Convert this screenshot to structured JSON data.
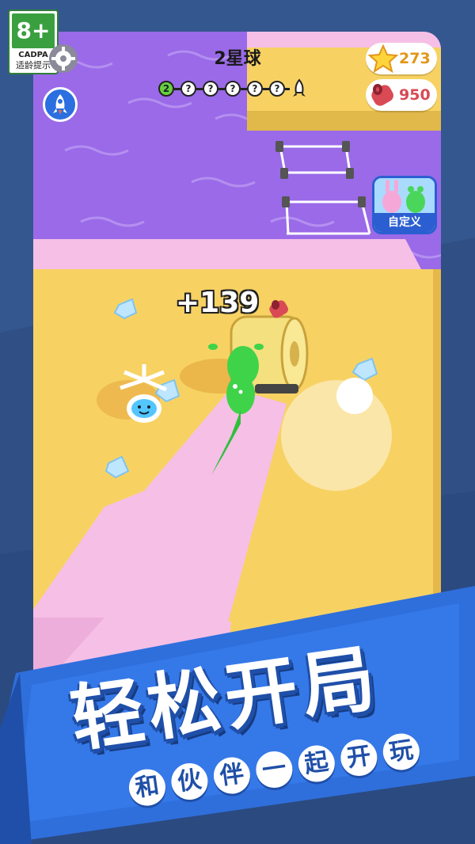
{
  "age_rating": {
    "badge": "8+",
    "org": "CADPA",
    "caption": "适龄提示"
  },
  "hud": {
    "planet_title": "2星球",
    "current_level": "2",
    "locked_levels": [
      "?",
      "?",
      "?",
      "?",
      "?"
    ],
    "stars_count": "273",
    "carpet_count": "950",
    "customize_label": "自定义",
    "icons": {
      "settings": "gear-icon",
      "rocket": "rocket-icon",
      "star": "star-icon",
      "carpet": "carpet-roll-icon",
      "goal": "rocket-goal-icon"
    }
  },
  "game": {
    "score_popup": "+139"
  },
  "banner": {
    "headline": "轻松开局",
    "subtitle_chars": [
      "和",
      "伙",
      "伴",
      "一",
      "起",
      "开",
      "玩"
    ]
  },
  "colors": {
    "background": "#2f4f85",
    "sand": "#f7d263",
    "carpet_pink": "#f6bfe6",
    "water": "#9a6ae8",
    "banner_blue": "#2f6fdc",
    "star_gold": "#ffd43a",
    "carpet_red": "#d94a55"
  }
}
